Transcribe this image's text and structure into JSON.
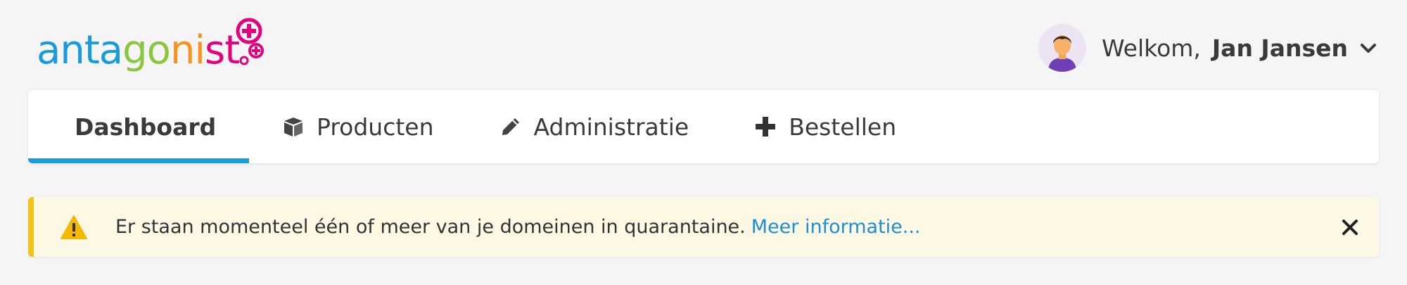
{
  "brand": {
    "name": "antagonist",
    "letter_colors": [
      "#1a9be0",
      "#1a9be0",
      "#1a9be0",
      "#1a9be0",
      "#8cc63f",
      "#8cc63f",
      "#f7941d",
      "#f7941d",
      "#e5007e",
      "#e5007e"
    ],
    "accent_pink": "#e5007e"
  },
  "user_menu": {
    "welcome": "Welkom,",
    "name": "Jan Jansen",
    "avatar_icon": "avatar-person-icon",
    "dropdown_icon": "chevron-down-icon"
  },
  "nav": {
    "tabs": [
      {
        "label": "Dashboard",
        "icon": "grid-icon",
        "active": true
      },
      {
        "label": "Producten",
        "icon": "box-icon",
        "active": false
      },
      {
        "label": "Administratie",
        "icon": "pencil-icon",
        "active": false
      },
      {
        "label": "Bestellen",
        "icon": "plus-icon",
        "active": false
      }
    ],
    "active_color": "#1a9be0"
  },
  "alert": {
    "message": "Er staan momenteel één of meer van je domeinen in quarantaine.",
    "link_text": "Meer informatie...",
    "icon": "warning-icon",
    "close_icon": "close-icon",
    "background": "#fcf8e3",
    "accent": "#f0c419"
  }
}
